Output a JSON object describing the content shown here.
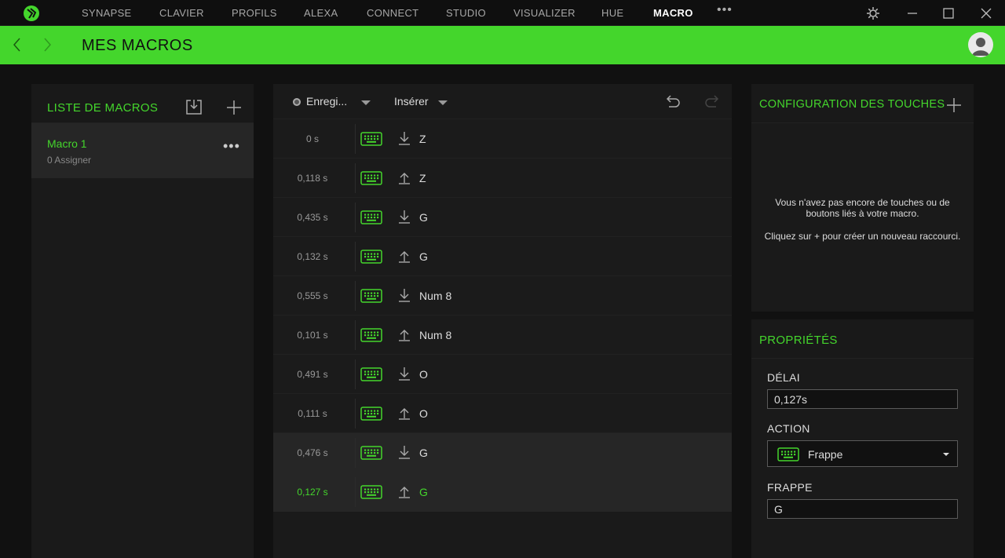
{
  "nav": {
    "items": [
      "SYNAPSE",
      "CLAVIER",
      "PROFILS",
      "ALEXA",
      "CONNECT",
      "STUDIO",
      "VISUALIZER",
      "HUE",
      "MACRO"
    ],
    "active": "MACRO",
    "more": "•••"
  },
  "header": {
    "title": "MES MACROS"
  },
  "macro_list": {
    "title": "LISTE DE MACROS",
    "items": [
      {
        "name": "Macro 1",
        "sub": "0 Assigner"
      }
    ]
  },
  "toolbar": {
    "record_label": "Enregi...",
    "insert_label": "Insérer"
  },
  "events": [
    {
      "time": "0 s",
      "direction": "down",
      "key": "Z"
    },
    {
      "time": "0,118 s",
      "direction": "up",
      "key": "Z"
    },
    {
      "time": "0,435 s",
      "direction": "down",
      "key": "G"
    },
    {
      "time": "0,132 s",
      "direction": "up",
      "key": "G"
    },
    {
      "time": "0,555 s",
      "direction": "down",
      "key": "Num 8"
    },
    {
      "time": "0,101 s",
      "direction": "up",
      "key": "Num 8"
    },
    {
      "time": "0,491 s",
      "direction": "down",
      "key": "O"
    },
    {
      "time": "0,111 s",
      "direction": "up",
      "key": "O"
    },
    {
      "time": "0,476 s",
      "direction": "down",
      "key": "G"
    },
    {
      "time": "0,127 s",
      "direction": "up",
      "key": "G"
    }
  ],
  "key_config": {
    "title": "CONFIGURATION DES TOUCHES",
    "empty_line1": "Vous n'avez pas encore de touches ou de",
    "empty_line2": "boutons liés à votre macro.",
    "empty_line3": "Cliquez sur + pour créer un nouveau raccourci."
  },
  "properties": {
    "title": "PROPRIÉTÉS",
    "delay_label": "DÉLAI",
    "delay_value": "0,127s",
    "action_label": "ACTION",
    "action_value": "Frappe",
    "keystroke_label": "FRAPPE",
    "keystroke_value": "G"
  },
  "colors": {
    "accent": "#44d62c",
    "background": "#111111",
    "panel": "#1a1a1a"
  }
}
